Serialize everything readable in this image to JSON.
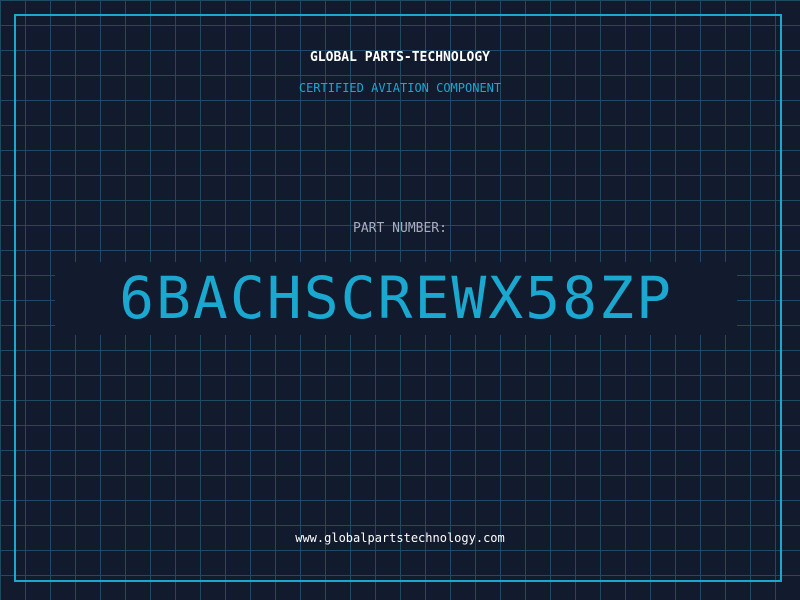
{
  "header": {
    "brand": "GLOBAL PARTS-TECHNOLOGY",
    "subtitle": "CERTIFIED AVIATION COMPONENT"
  },
  "part": {
    "label": "PART NUMBER:",
    "number": "6BACHSCREWX58ZP"
  },
  "footer": {
    "website": "www.globalpartstechnology.com"
  },
  "colors": {
    "background": "#121a2e",
    "grid": "#1e4a63",
    "accent": "#1aa8d0",
    "text": "#ffffff",
    "muted": "#a7aebd"
  }
}
